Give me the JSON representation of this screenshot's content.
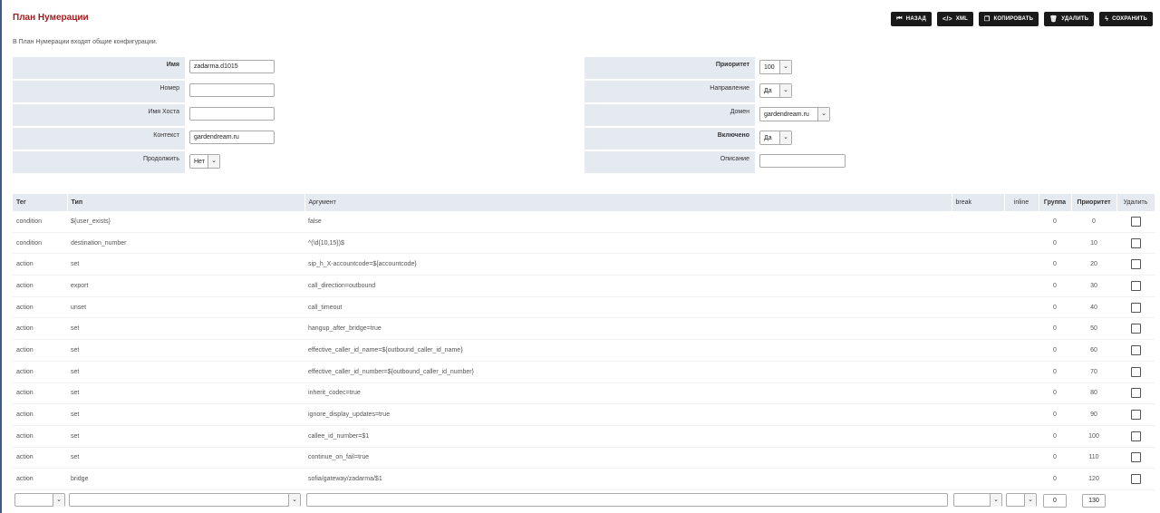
{
  "header": {
    "title": "План Нумерации",
    "description": "В План Нумерации входят общие конфигурации."
  },
  "toolbar": {
    "back": "НАЗАД",
    "xml": "XML",
    "copy": "КОПИРОВАТЬ",
    "delete": "УДАЛИТЬ",
    "save": "СОХРАНИТЬ"
  },
  "form": {
    "name_label": "Имя",
    "name_value": "zadarma.d1015",
    "number_label": "Номер",
    "number_value": "",
    "hostname_label": "Имя Хоста",
    "hostname_value": "",
    "context_label": "Контекст",
    "context_value": "gardendream.ru",
    "continue_label": "Продолжить",
    "continue_value": "Нет",
    "priority_label": "Приоритет",
    "priority_value": "100",
    "direction_label": "Направление",
    "direction_value": "Да",
    "domain_label": "Домен",
    "domain_value": "gardendream.ru",
    "enabled_label": "Включено",
    "enabled_value": "Да",
    "description_label": "Описание",
    "description_value": ""
  },
  "table": {
    "headers": {
      "tag": "Тег",
      "type": "Тип",
      "argument": "Аргумент",
      "break": "break",
      "inline": "inline",
      "group": "Группа",
      "priority": "Приоритет",
      "delete": "Удалить"
    },
    "rows": [
      {
        "tag": "condition",
        "type": "${user_exists}",
        "argument": "false",
        "group": "0",
        "priority": "0"
      },
      {
        "tag": "condition",
        "type": "destination_number",
        "argument": "^(\\d{10,15})$",
        "group": "0",
        "priority": "10"
      },
      {
        "tag": "action",
        "type": "set",
        "argument": "sip_h_X-accountcode=${accountcode}",
        "group": "0",
        "priority": "20"
      },
      {
        "tag": "action",
        "type": "export",
        "argument": "call_direction=outbound",
        "group": "0",
        "priority": "30"
      },
      {
        "tag": "action",
        "type": "unset",
        "argument": "call_timeout",
        "group": "0",
        "priority": "40"
      },
      {
        "tag": "action",
        "type": "set",
        "argument": "hangup_after_bridge=true",
        "group": "0",
        "priority": "50"
      },
      {
        "tag": "action",
        "type": "set",
        "argument": "effective_caller_id_name=${outbound_caller_id_name}",
        "group": "0",
        "priority": "60"
      },
      {
        "tag": "action",
        "type": "set",
        "argument": "effective_caller_id_number=${outbound_caller_id_number}",
        "group": "0",
        "priority": "70"
      },
      {
        "tag": "action",
        "type": "set",
        "argument": "inherit_codec=true",
        "group": "0",
        "priority": "80"
      },
      {
        "tag": "action",
        "type": "set",
        "argument": "ignore_display_updates=true",
        "group": "0",
        "priority": "90"
      },
      {
        "tag": "action",
        "type": "set",
        "argument": "callee_id_number=$1",
        "group": "0",
        "priority": "100"
      },
      {
        "tag": "action",
        "type": "set",
        "argument": "continue_on_fail=true",
        "group": "0",
        "priority": "110"
      },
      {
        "tag": "action",
        "type": "bridge",
        "argument": "sofia/gateway/zadarma/$1",
        "group": "0",
        "priority": "120"
      }
    ],
    "new_row": {
      "group": "0",
      "priority": "130"
    }
  }
}
